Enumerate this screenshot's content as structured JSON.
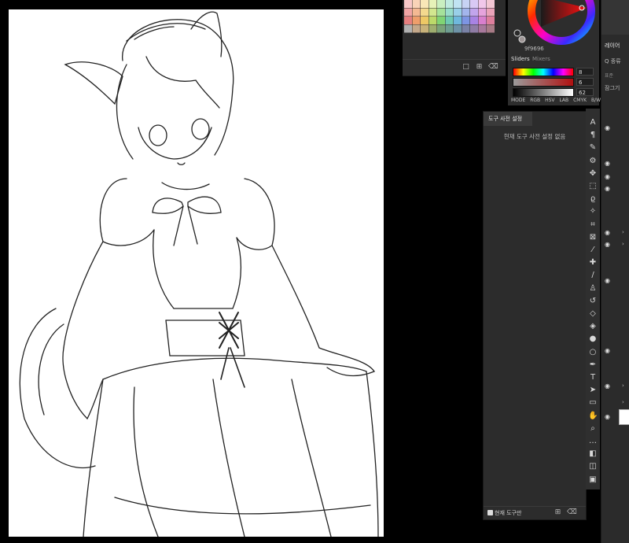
{
  "swatches": {
    "colors": [
      "#f7c7c7",
      "#f9d3b8",
      "#f8e7b7",
      "#e6f2b8",
      "#c9efc0",
      "#bfeadf",
      "#c0e3f2",
      "#c7d3f4",
      "#d9c9f4",
      "#f1c7ea",
      "#f3c6d3",
      "#f0a4a4",
      "#f4b993",
      "#f3d98e",
      "#d2e78f",
      "#a5e29a",
      "#98dcca",
      "#99cfe8",
      "#a3b5ec",
      "#c2a5ec",
      "#e6a3dc",
      "#eaa2b8",
      "#e57f7f",
      "#ee9e6b",
      "#edc865",
      "#bcd96a",
      "#80d474",
      "#6fcab3",
      "#6fb8dd",
      "#7d95e3",
      "#a883e3",
      "#d97fcd",
      "#de7e9c",
      "#b0b0b0",
      "#c4a88a",
      "#c8b27a",
      "#9fae6f",
      "#7ba37a",
      "#6f9e92",
      "#6e93a8",
      "#7a82a6",
      "#8f7ca5",
      "#a8799c",
      "#a87b86"
    ],
    "footer_icons": [
      "folder-icon",
      "new-swatch-icon",
      "trash-icon"
    ]
  },
  "color": {
    "hex": "9f9696",
    "tab_active": "Sliders",
    "tab_inactive": "Mixers",
    "values": [
      "8",
      "6",
      "62"
    ],
    "modes": [
      "MODE",
      "RGB",
      "HSV",
      "LAB",
      "CMYK",
      "B/W"
    ],
    "accent_red": "#e8151a"
  },
  "presets": {
    "tab_label": "도구 사전 설정",
    "empty_message": "현재 도구 사전 설정 없음",
    "current_tool_label": "현재 도구만"
  },
  "toolbar": {
    "icons": [
      "type-a-icon",
      "paragraph-icon",
      "brush-settings-icon",
      "adjust-icon",
      "move-icon",
      "marquee-icon",
      "lasso-icon",
      "magic-wand-icon",
      "crop-icon",
      "frame-icon",
      "eyedropper-icon",
      "healing-icon",
      "brush-icon",
      "stamp-icon",
      "history-brush-icon",
      "eraser-icon",
      "bucket-icon",
      "blur-icon",
      "dodge-icon",
      "pen-icon",
      "text-icon",
      "select-arrow-icon",
      "rectangle-icon",
      "hand-icon",
      "zoom-icon",
      "more-icon",
      "colors-icon",
      "quickmask-icon",
      "screen-mode-icon"
    ]
  },
  "layers": {
    "tab_label": "레이어",
    "kind_label": "Q 종류",
    "mode_label": "표준",
    "lock_label": "잠그기"
  }
}
